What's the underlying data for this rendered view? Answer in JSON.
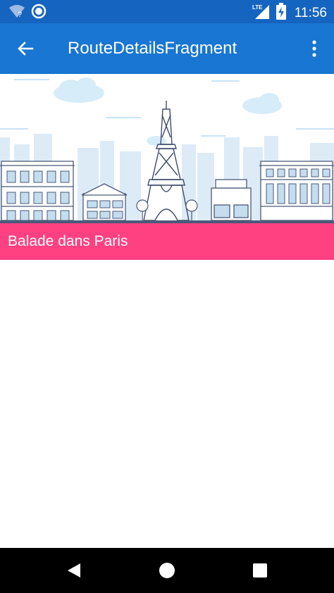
{
  "status_bar": {
    "time": "11:56",
    "network_label": "LTE",
    "icons": [
      "wifi-unknown-icon",
      "sync-icon",
      "lte-signal-icon",
      "battery-charging-icon"
    ]
  },
  "app_bar": {
    "title": "RouteDetailsFragment",
    "back_icon": "arrow-back-icon",
    "menu_icon": "more-vert-icon",
    "color": "#1976d2"
  },
  "hero_image": {
    "subject": "paris-eiffel-tower-illustration"
  },
  "route": {
    "name": "Balade dans Paris",
    "banner_color": "#ff4081"
  },
  "nav_bar": {
    "buttons": [
      "back-triangle-icon",
      "home-circle-icon",
      "recents-square-icon"
    ]
  }
}
